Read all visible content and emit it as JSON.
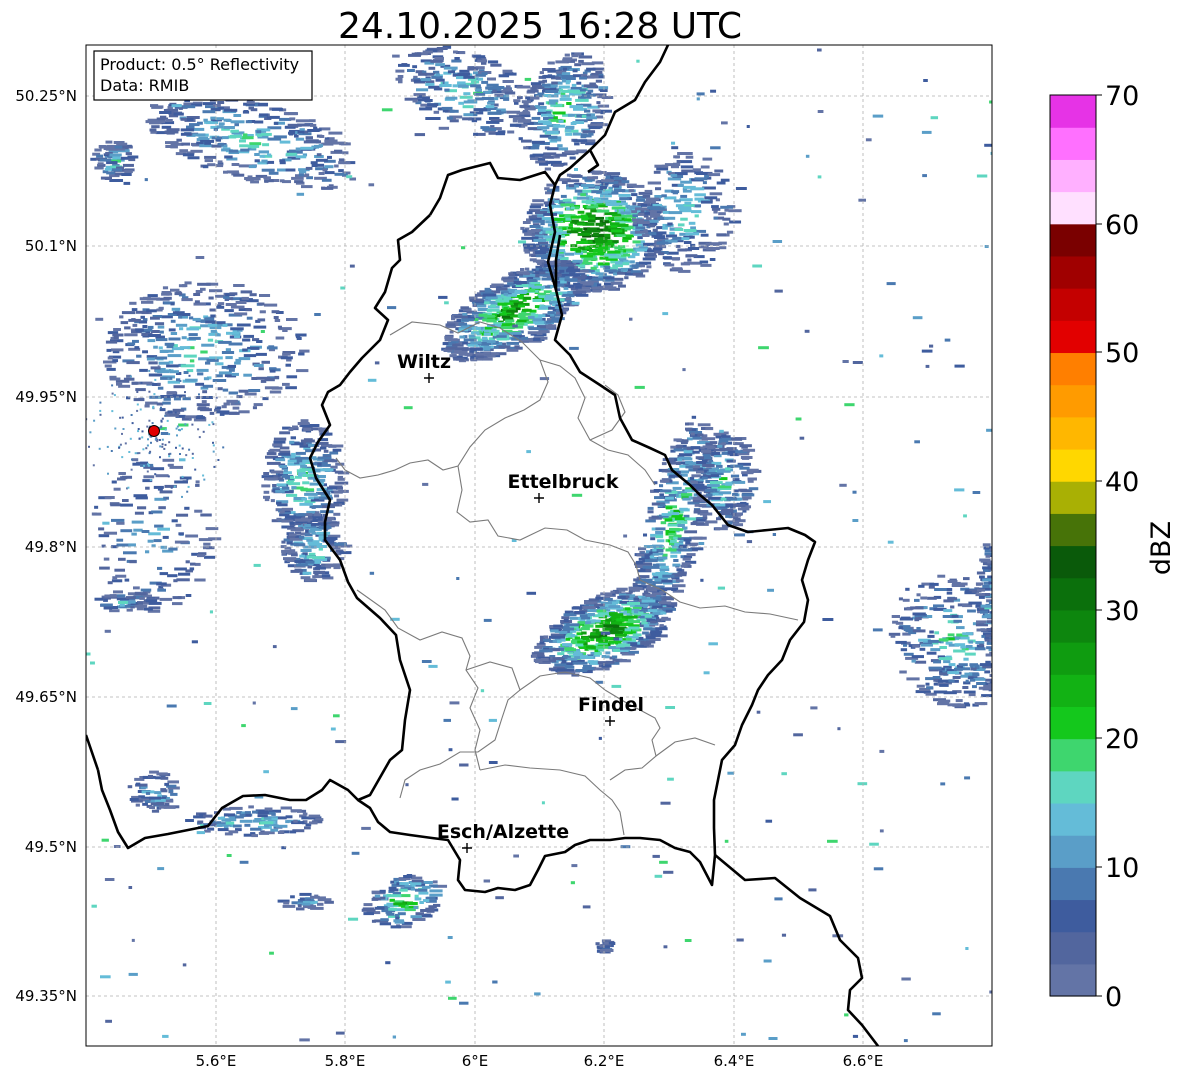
{
  "title": "24.10.2025 16:28 UTC",
  "info_box": {
    "product": "Product: 0.5° Reflectivity",
    "source": "Data: RMIB"
  },
  "lat_labels": [
    "50.25°N",
    "50.1°N",
    "49.95°N",
    "49.8°N",
    "49.65°N",
    "49.5°N",
    "49.35°N"
  ],
  "lon_labels": [
    "5.6°E",
    "5.8°E",
    "6°E",
    "6.2°E",
    "6.4°E",
    "6.6°E"
  ],
  "cities": [
    {
      "name": "Wiltz"
    },
    {
      "name": "Ettelbruck"
    },
    {
      "name": "Findel"
    },
    {
      "name": "Esch/Alzette"
    }
  ],
  "colorbar": {
    "label": "dBZ",
    "ticks": [
      "0",
      "10",
      "20",
      "30",
      "40",
      "50",
      "60",
      "70"
    ],
    "colors": [
      "#6374a6",
      "#52669e",
      "#3e5c9e",
      "#4a79b0",
      "#5a9ec8",
      "#64bcd8",
      "#5ed6c0",
      "#3ed66e",
      "#14c81c",
      "#12b214",
      "#0f9c10",
      "#0d860e",
      "#0b700c",
      "#0a5a0a",
      "#477308",
      "#a9b004",
      "#ffd700",
      "#ffb700",
      "#ff9b00",
      "#ff7f00",
      "#e20000",
      "#c40000",
      "#a00000",
      "#7a0000",
      "#ffe0ff",
      "#ffb0ff",
      "#ff70ff",
      "#e633e6"
    ]
  },
  "radar_site_color": "#e00000"
}
